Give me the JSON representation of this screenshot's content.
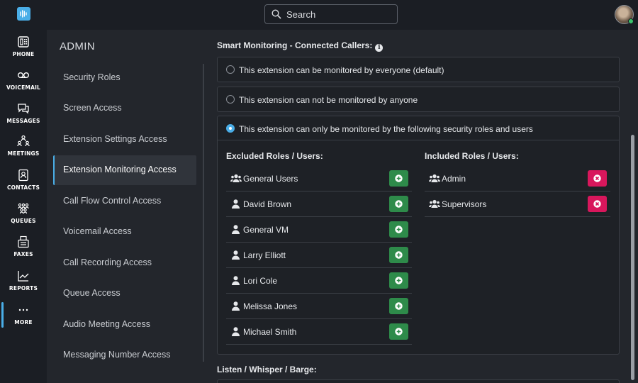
{
  "rail": {
    "items": [
      {
        "label": "PHONE",
        "icon": "phone-icon"
      },
      {
        "label": "VOICEMAIL",
        "icon": "voicemail-icon"
      },
      {
        "label": "MESSAGES",
        "icon": "messages-icon"
      },
      {
        "label": "MEETINGS",
        "icon": "meetings-icon"
      },
      {
        "label": "CONTACTS",
        "icon": "contacts-icon"
      },
      {
        "label": "QUEUES",
        "icon": "queues-icon"
      },
      {
        "label": "FAXES",
        "icon": "fax-icon"
      },
      {
        "label": "REPORTS",
        "icon": "reports-icon"
      },
      {
        "label": "MORE",
        "icon": "more-icon"
      }
    ],
    "active": "MORE"
  },
  "header": {
    "search_placeholder": "Search"
  },
  "admin": {
    "title": "ADMIN",
    "items": [
      "Security Roles",
      "Screen Access",
      "Extension Settings Access",
      "Extension Monitoring Access",
      "Call Flow Control Access",
      "Voicemail Access",
      "Call Recording Access",
      "Queue Access",
      "Audio Meeting Access",
      "Messaging Number Access"
    ],
    "active_index": 3
  },
  "main": {
    "section_title": "Smart Monitoring - Connected Callers:",
    "options": [
      "This extension can be monitored by everyone (default)",
      "This extension can not be monitored by anyone",
      "This extension can only be monitored by the following security roles and users"
    ],
    "selected_option": 2,
    "excluded_title": "Excluded Roles / Users:",
    "included_title": "Included Roles / Users:",
    "excluded": [
      {
        "name": "General Users",
        "type": "group"
      },
      {
        "name": "David Brown",
        "type": "user"
      },
      {
        "name": "General VM",
        "type": "user"
      },
      {
        "name": "Larry Elliott",
        "type": "user"
      },
      {
        "name": "Lori Cole",
        "type": "user"
      },
      {
        "name": "Melissa Jones",
        "type": "user"
      },
      {
        "name": "Michael Smith",
        "type": "user"
      }
    ],
    "included": [
      {
        "name": "Admin",
        "type": "group"
      },
      {
        "name": "Supervisors",
        "type": "group"
      }
    ],
    "next_section_title": "Listen / Whisper / Barge:"
  },
  "colors": {
    "accent": "#4aaee8",
    "add_button": "#2e8b4a",
    "remove_button": "#d8175c"
  }
}
